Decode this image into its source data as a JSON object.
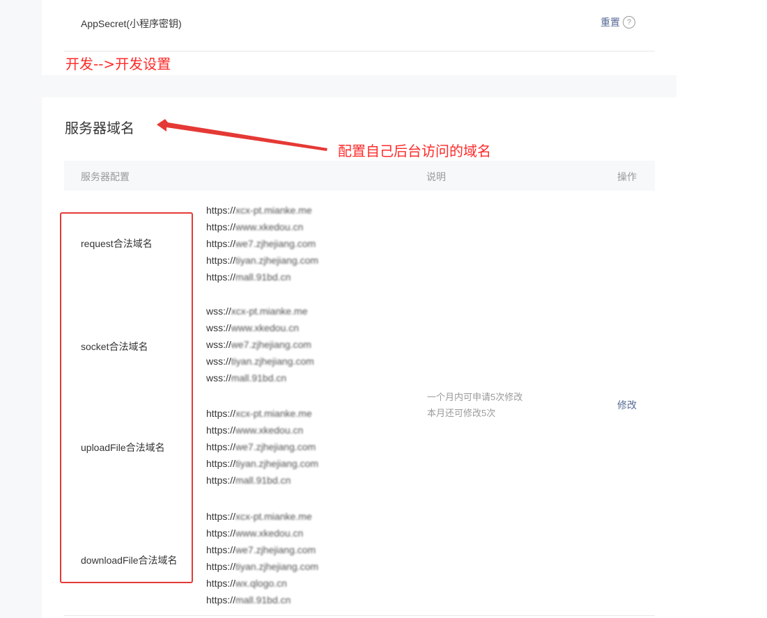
{
  "appsecret": {
    "label": "AppSecret(小程序密钥)",
    "reset_label": "重置",
    "help_icon": "?"
  },
  "annotations": {
    "path_note": "开发-->开发设置",
    "config_note": "配置自己后台访问的域名",
    "color": "#ff2a2a"
  },
  "server_domain": {
    "title": "服务器域名",
    "table_headers": {
      "server": "服务器配置",
      "desc": "说明",
      "op": "操作"
    },
    "rows": [
      {
        "label": "request合法域名",
        "urls": [
          {
            "prefix": "https://",
            "rest": "xcx-pt.mianke.me"
          },
          {
            "prefix": "https://",
            "rest": "www.xkedou.cn"
          },
          {
            "prefix": "https://",
            "rest": "we7.zjhejiang.com"
          },
          {
            "prefix": "https://",
            "rest": "tiyan.zjhejiang.com"
          },
          {
            "prefix": "https://",
            "rest": "mall.91bd.cn"
          }
        ]
      },
      {
        "label": "socket合法域名",
        "urls": [
          {
            "prefix": "wss://",
            "rest": "xcx-pt.mianke.me"
          },
          {
            "prefix": "wss://",
            "rest": "www.xkedou.cn"
          },
          {
            "prefix": "wss://",
            "rest": "we7.zjhejiang.com"
          },
          {
            "prefix": "wss://",
            "rest": "tiyan.zjhejiang.com"
          },
          {
            "prefix": "wss://",
            "rest": "mall.91bd.cn"
          }
        ]
      },
      {
        "label": "uploadFile合法域名",
        "urls": [
          {
            "prefix": "https://",
            "rest": "xcx-pt.mianke.me"
          },
          {
            "prefix": "https://",
            "rest": "www.xkedou.cn"
          },
          {
            "prefix": "https://",
            "rest": "we7.zjhejiang.com"
          },
          {
            "prefix": "https://",
            "rest": "tiyan.zjhejiang.com"
          },
          {
            "prefix": "https://",
            "rest": "mall.91bd.cn"
          }
        ]
      },
      {
        "label": "downloadFile合法域名",
        "urls": [
          {
            "prefix": "https://",
            "rest": "xcx-pt.mianke.me"
          },
          {
            "prefix": "https://",
            "rest": "www.xkedou.cn"
          },
          {
            "prefix": "https://",
            "rest": "we7.zjhejiang.com"
          },
          {
            "prefix": "https://",
            "rest": "tiyan.zjhejiang.com"
          },
          {
            "prefix": "https://",
            "rest": "wx.qlogo.cn"
          },
          {
            "prefix": "https://",
            "rest": "mall.91bd.cn"
          }
        ]
      }
    ],
    "desc_line1": "一个月内可申请5次修改",
    "desc_line2": "本月还可修改5次",
    "modify_label": "修改"
  }
}
